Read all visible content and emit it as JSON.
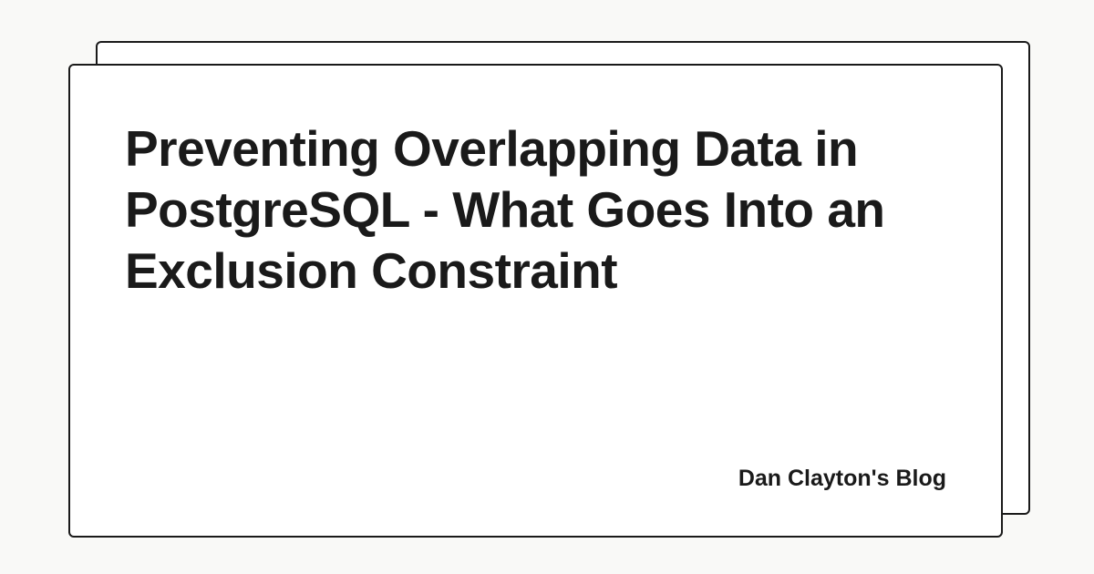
{
  "card": {
    "title": "Preventing Overlapping Data in PostgreSQL - What Goes Into an Exclusion Constraint",
    "author": "Dan Clayton's Blog"
  }
}
